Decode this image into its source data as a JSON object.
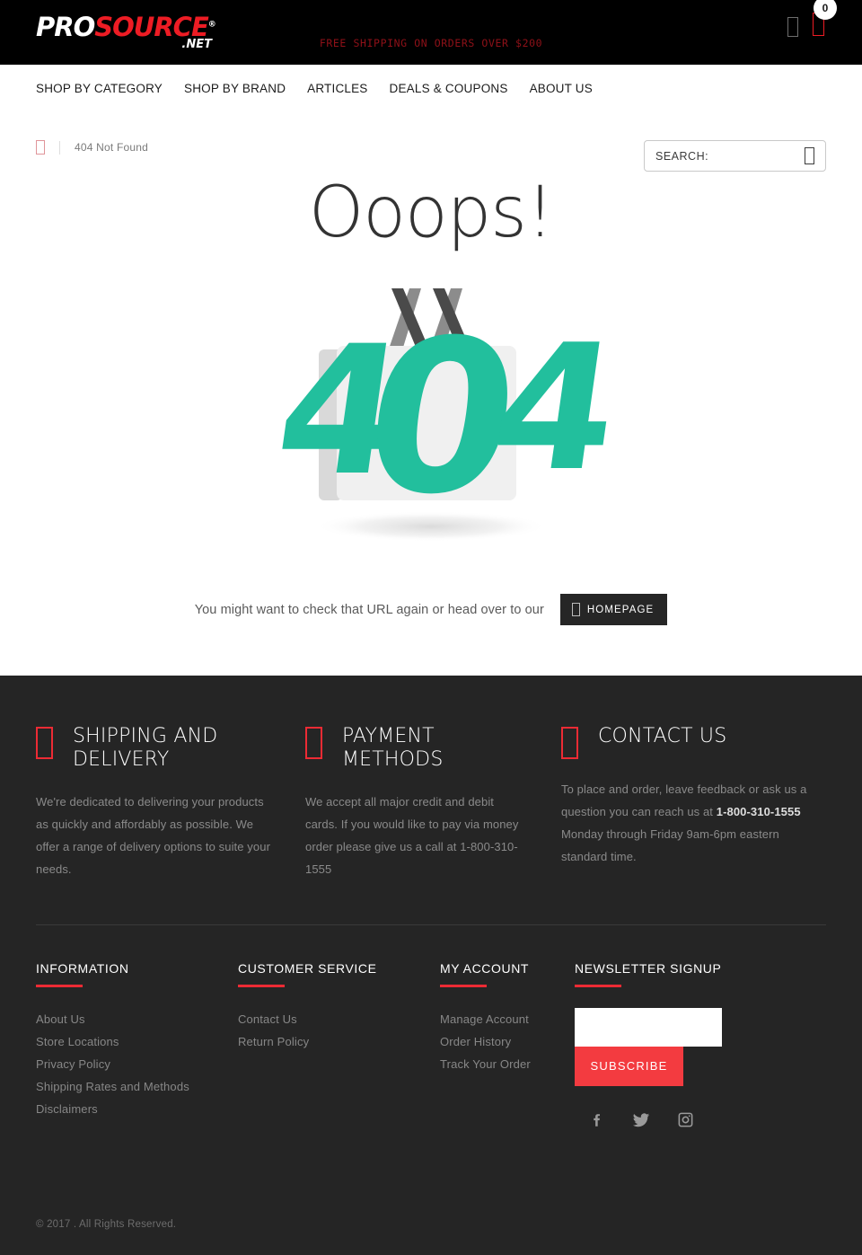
{
  "header": {
    "logo": {
      "part1": "PRO",
      "part2": "SOURCE",
      "registered": "®",
      "tld": ".NET"
    },
    "promo": "FREE SHIPPING ON ORDERS OVER $200",
    "wishlist_icon": "heart-icon",
    "cart_icon": "cart-icon",
    "cart_count": "0"
  },
  "nav": {
    "items": [
      {
        "label": "SHOP BY CATEGORY"
      },
      {
        "label": "SHOP BY BRAND"
      },
      {
        "label": "ARTICLES"
      },
      {
        "label": "DEALS & COUPONS"
      },
      {
        "label": "ABOUT US"
      }
    ]
  },
  "search": {
    "placeholder": "SEARCH:",
    "value": "",
    "icon": "search-icon"
  },
  "breadcrumb": {
    "home_icon": "home-icon",
    "current": "404 Not Found"
  },
  "hero": {
    "heading": "Ooops!",
    "message": "You might want to check that URL again or head over to our",
    "button_label": "HOMEPAGE",
    "button_icon": "home-icon",
    "art": {
      "code": "404",
      "teal": "#22bf9d",
      "bag_light": "#f0f0f0",
      "bag_shade": "#d8d8d8",
      "handle_light": "#8c8c8c",
      "handle_dark": "#4a4a4a"
    }
  },
  "footer": {
    "features": [
      {
        "icon": "truck-icon",
        "title": "SHIPPING AND DELIVERY",
        "body": "We're dedicated to delivering your products as quickly and affordably as possible. We offer a range of delivery options to suite your needs."
      },
      {
        "icon": "credit-card-icon",
        "title": "PAYMENT METHODS",
        "body": "We accept all major credit and debit cards. If you would like to pay via money order please give us a call at 1-800-310-1555"
      },
      {
        "icon": "phone-icon",
        "title": "CONTACT US",
        "body_pre": "To place and order, leave feedback or ask us a question you can reach us at ",
        "body_phone": "1-800-310-1555",
        "body_post": " Monday through Friday 9am-6pm eastern standard time."
      }
    ],
    "link_columns": [
      {
        "heading": "INFORMATION",
        "links": [
          {
            "label": "About Us"
          },
          {
            "label": "Store Locations"
          },
          {
            "label": "Privacy Policy"
          },
          {
            "label": "Shipping Rates and Methods"
          },
          {
            "label": "Disclaimers"
          }
        ]
      },
      {
        "heading": "CUSTOMER SERVICE",
        "links": [
          {
            "label": "Contact Us"
          },
          {
            "label": "Return Policy"
          }
        ]
      },
      {
        "heading": "MY ACCOUNT",
        "links": [
          {
            "label": "Manage Account"
          },
          {
            "label": "Order History"
          },
          {
            "label": "Track Your Order"
          }
        ]
      }
    ],
    "newsletter": {
      "heading": "NEWSLETTER SIGNUP",
      "input_value": "",
      "input_placeholder": "",
      "button_label": "SUBSCRIBE"
    },
    "socials": [
      {
        "name": "facebook-icon"
      },
      {
        "name": "twitter-icon"
      },
      {
        "name": "instagram-icon"
      }
    ],
    "copyright": "© 2017 . All Rights Reserved."
  },
  "colors": {
    "brand_red": "#ed1c24",
    "accent_red": "#f33b40",
    "footer_bg": "#252525",
    "teal": "#22bf9d"
  }
}
